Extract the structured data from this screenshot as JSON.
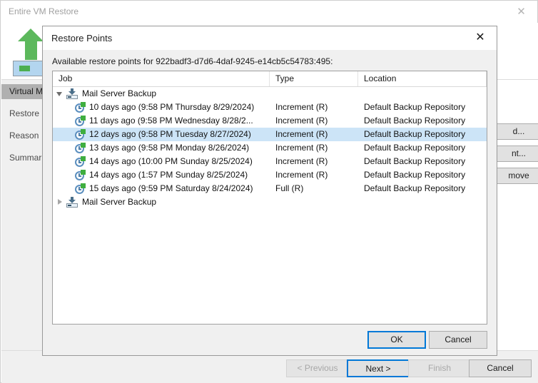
{
  "wizard": {
    "title": "Entire VM Restore",
    "close_icon": "close-icon",
    "icon_name": "vm-restore-icon",
    "steps": [
      {
        "label": "Virtual M",
        "selected": true
      },
      {
        "label": "Restore",
        "selected": false
      },
      {
        "label": "Reason",
        "selected": false
      },
      {
        "label": "Summar",
        "selected": false
      }
    ],
    "side_buttons": [
      {
        "label": "d..."
      },
      {
        "label": "nt..."
      },
      {
        "label": "move"
      }
    ],
    "footer_buttons": [
      {
        "label": "< Previous",
        "state": "disabled"
      },
      {
        "label": "Next >",
        "state": "default"
      },
      {
        "label": "Finish",
        "state": "disabled"
      },
      {
        "label": "Cancel",
        "state": "normal"
      }
    ]
  },
  "dialog": {
    "title": "Restore Points",
    "close_icon": "close-icon",
    "description": "Available restore points for 922badf3-d7d6-4daf-9245-e14cb5c54783:495:",
    "columns": [
      {
        "label": "Job"
      },
      {
        "label": "Type"
      },
      {
        "label": "Location"
      }
    ],
    "rows": [
      {
        "kind": "group",
        "expanded": true,
        "expander_icon": "triangle-down-icon",
        "icon": "backup-job-icon",
        "job": "Mail Server Backup",
        "type": "",
        "location": "",
        "selected": false
      },
      {
        "kind": "point",
        "icon": "restore-point-clock-icon",
        "job": "10 days ago (9:58 PM Thursday 8/29/2024)",
        "type": "Increment (R)",
        "location": "Default Backup Repository",
        "selected": false
      },
      {
        "kind": "point",
        "icon": "restore-point-clock-icon",
        "job": "11 days ago (9:58 PM Wednesday 8/28/2...",
        "type": "Increment (R)",
        "location": "Default Backup Repository",
        "selected": false
      },
      {
        "kind": "point",
        "icon": "restore-point-clock-icon",
        "job": "12 days ago (9:58 PM Tuesday 8/27/2024)",
        "type": "Increment (R)",
        "location": "Default Backup Repository",
        "selected": true
      },
      {
        "kind": "point",
        "icon": "restore-point-clock-icon",
        "job": "13 days ago (9:58 PM Monday 8/26/2024)",
        "type": "Increment (R)",
        "location": "Default Backup Repository",
        "selected": false
      },
      {
        "kind": "point",
        "icon": "restore-point-clock-icon",
        "job": "14 days ago (10:00 PM Sunday 8/25/2024)",
        "type": "Increment (R)",
        "location": "Default Backup Repository",
        "selected": false
      },
      {
        "kind": "point",
        "icon": "restore-point-clock-icon",
        "job": "14 days ago (1:57 PM Sunday 8/25/2024)",
        "type": "Increment (R)",
        "location": "Default Backup Repository",
        "selected": false
      },
      {
        "kind": "point",
        "icon": "restore-point-clock-icon",
        "job": "15 days ago (9:59 PM Saturday 8/24/2024)",
        "type": "Full (R)",
        "location": "Default Backup Repository",
        "selected": false
      },
      {
        "kind": "group",
        "expanded": false,
        "expander_icon": "triangle-right-icon",
        "icon": "backup-job-icon",
        "job": "Mail Server Backup",
        "type": "",
        "location": "",
        "selected": false
      }
    ],
    "buttons": [
      {
        "label": "OK",
        "state": "default"
      },
      {
        "label": "Cancel",
        "state": "normal"
      }
    ]
  },
  "colors": {
    "accent": "#0078d7",
    "selection": "#cce4f7",
    "green": "#5cb85c",
    "dialog_bg": "#f0f0f0"
  }
}
